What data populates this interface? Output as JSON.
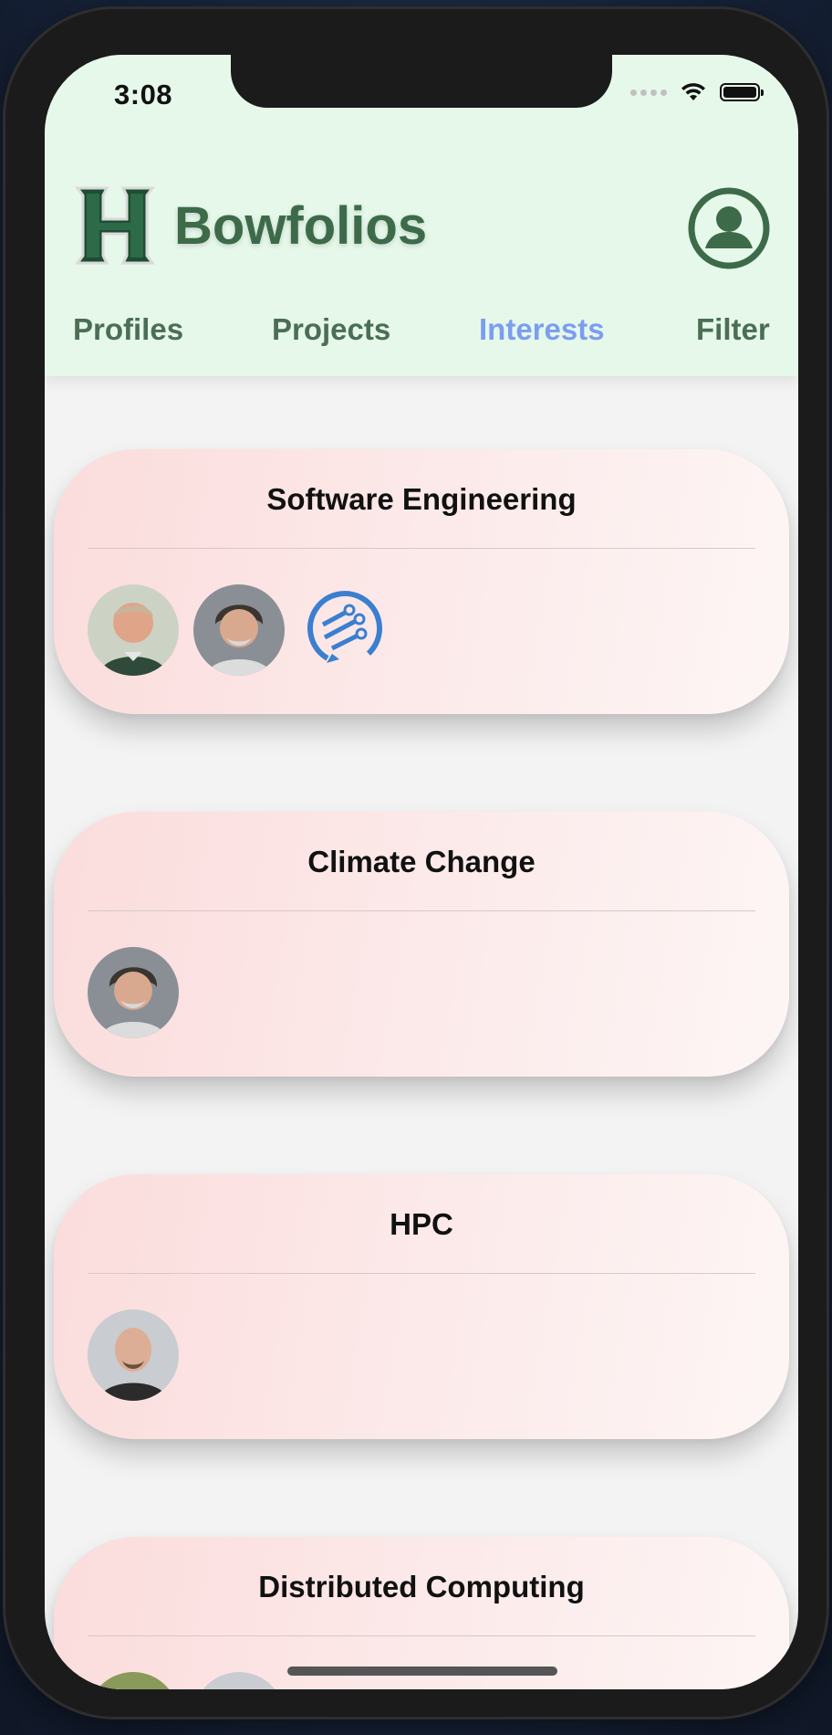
{
  "status_bar": {
    "time": "3:08"
  },
  "header": {
    "app_title": "Bowfolios",
    "logo_icon": "h-logo-icon",
    "profile_icon": "user-circle-icon",
    "brand_color": "#3d6b4a",
    "active_color": "#7b9ef0"
  },
  "tabs": [
    {
      "label": "Profiles",
      "active": false
    },
    {
      "label": "Projects",
      "active": false
    },
    {
      "label": "Interests",
      "active": true
    },
    {
      "label": "Filter",
      "active": false
    }
  ],
  "interests": [
    {
      "name": "Software Engineering",
      "members": [
        "avatar-person",
        "avatar-person",
        "project-logo-icon"
      ]
    },
    {
      "name": "Climate Change",
      "members": [
        "avatar-person"
      ]
    },
    {
      "name": "HPC",
      "members": [
        "avatar-person"
      ]
    },
    {
      "name": "Distributed Computing",
      "members": [
        "avatar-person",
        "avatar-person"
      ]
    }
  ]
}
